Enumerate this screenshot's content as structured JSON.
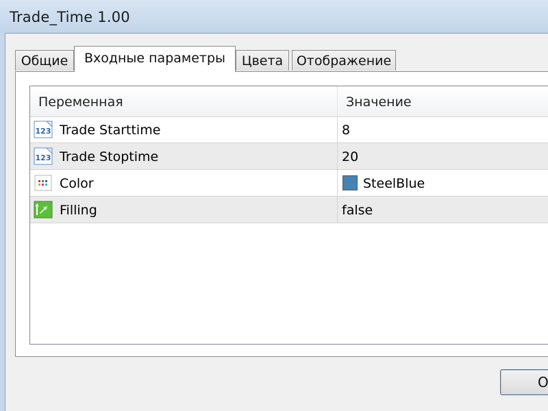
{
  "window": {
    "title": "Trade_Time 1.00"
  },
  "tabs": [
    {
      "label": "Общие"
    },
    {
      "label": "Входные параметры",
      "active": true
    },
    {
      "label": "Цвета"
    },
    {
      "label": "Отображение"
    }
  ],
  "table": {
    "columns": [
      "Переменная",
      "Значение"
    ],
    "rows": [
      {
        "icon": "integer-123-icon",
        "name": "Trade Starttime",
        "value": "8"
      },
      {
        "icon": "integer-123-icon",
        "name": "Trade Stoptime",
        "value": "20"
      },
      {
        "icon": "color-dots-icon",
        "name": "Color",
        "value": "SteelBlue",
        "swatch": "#4682b4"
      },
      {
        "icon": "boolean-arrow-icon",
        "name": "Filling",
        "value": "false"
      }
    ]
  },
  "buttons": {
    "ok_label": "OK"
  },
  "colors": {
    "titlebar": "#c6d7ea",
    "steelblue": "#4682b4"
  }
}
